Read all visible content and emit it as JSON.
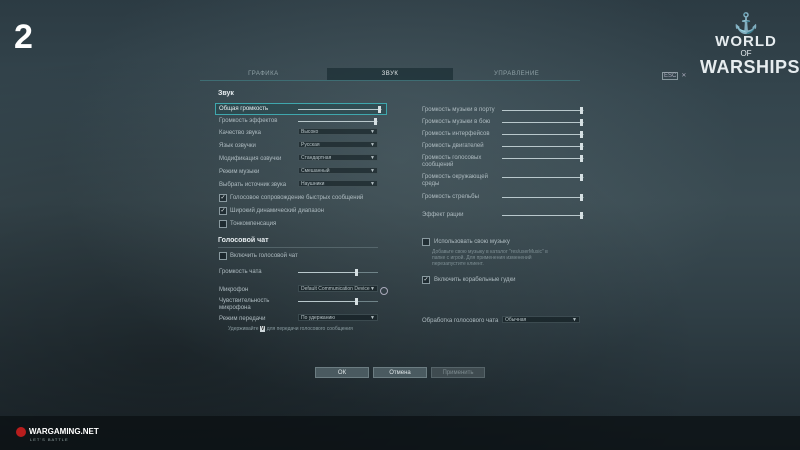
{
  "step_number": "2",
  "logo": {
    "line1": "WORLD",
    "line2": "OF",
    "line3": "WARSHIPS"
  },
  "tabs": [
    {
      "label": "ГРАФИКА",
      "active": false
    },
    {
      "label": "ЗВУК",
      "active": true
    },
    {
      "label": "УПРАВЛЕНИЕ",
      "active": false
    }
  ],
  "esc": {
    "key": "ESC",
    "close": "✕"
  },
  "sound": {
    "title": "Звук",
    "master_volume": {
      "label": "Общая громкость",
      "value": 1.0
    },
    "effects_volume": {
      "label": "Громкость эффектов",
      "value": 1.0
    },
    "quality": {
      "label": "Качество звука",
      "value": "Высоко"
    },
    "voice_language": {
      "label": "Язык озвучки",
      "value": "Русская"
    },
    "voice_mod": {
      "label": "Модификация озвучки",
      "value": "Стандартная"
    },
    "music_mode": {
      "label": "Режим музыки",
      "value": "Смешанный"
    },
    "sound_source": {
      "label": "Выбрать источник звука",
      "value": "Наушники"
    },
    "quick_msg_voice": {
      "label": "Голосовое сопровождение быстрых сообщений",
      "checked": true
    },
    "wide_range": {
      "label": "Широкий динамический диапазон",
      "checked": true
    },
    "tone_comp": {
      "label": "Тонкомпенсация",
      "checked": false
    }
  },
  "right": {
    "sliders": [
      {
        "label": "Громкость музыки в порту",
        "value": 1.0
      },
      {
        "label": "Громкость музыки в бою",
        "value": 1.0
      },
      {
        "label": "Громкость интерфейсов",
        "value": 1.0
      },
      {
        "label": "Громкость двигателей",
        "value": 1.0
      },
      {
        "label": "Громкость голосовых сообщений",
        "value": 1.0
      },
      {
        "label": "Громкость окружающей среды",
        "value": 1.0
      },
      {
        "label": "Громкость стрельбы",
        "value": 1.0
      },
      {
        "label": "Эффект рации",
        "value": 1.0
      }
    ],
    "own_music": {
      "label": "Использовать свою музыку",
      "checked": false
    },
    "own_music_note": "Добавьте свою музыку в каталог \"res/userMusic\" в папке с игрой. Для применения изменений перезапустите клиент.",
    "ship_horns": {
      "label": "Включить корабельные гудки",
      "checked": true
    },
    "voice_processing": {
      "label": "Обработка голосового чата",
      "value": "Обычная"
    }
  },
  "voice_chat": {
    "title": "Голосовой чат",
    "enable": {
      "label": "Включить голосовой чат",
      "checked": false
    },
    "volume": {
      "label": "Громкость чата",
      "value": 0.75
    },
    "mic": {
      "label": "Микрофон",
      "value": "Default Communication Device"
    },
    "sensitivity": {
      "label": "Чувствительность микрофона",
      "value": 0.75
    },
    "mode": {
      "label": "Режим передачи",
      "value": "По удержанию"
    },
    "hint_pre": "Удерживайте",
    "hint_key": "V",
    "hint_post": "для передачи голосового сообщения"
  },
  "buttons": {
    "ok": "ОК",
    "cancel": "Отмена",
    "apply": "Применить"
  },
  "footer": {
    "brand": "WARGAMING.NET",
    "tagline": "LET'S BATTLE"
  },
  "colors": {
    "accent": "#3fa7ad"
  }
}
